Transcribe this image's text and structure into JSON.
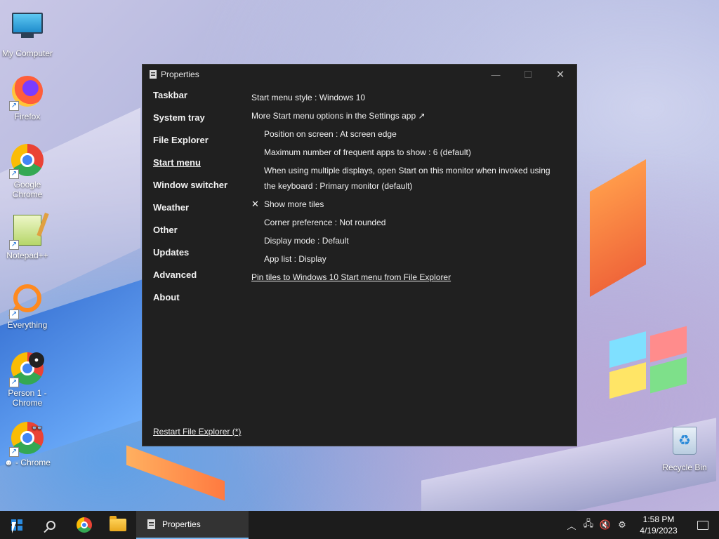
{
  "desktop": {
    "icons": [
      {
        "label": "My Computer",
        "icon": "monitor-icon"
      },
      {
        "label": "Firefox",
        "icon": "firefox-icon"
      },
      {
        "label": "Google Chrome",
        "icon": "chrome-icon"
      },
      {
        "label": "Notepad++",
        "icon": "notepad-plus-plus-icon"
      },
      {
        "label": "Everything",
        "icon": "everything-search-icon"
      },
      {
        "label": "Person 1 - Chrome",
        "icon": "chrome-profile-icon"
      },
      {
        "label": "☻ - Chrome",
        "icon": "chrome-profile-icon"
      },
      {
        "label": "Recycle Bin",
        "icon": "recycle-bin-icon"
      }
    ]
  },
  "window": {
    "title": "Properties",
    "controls": {
      "minimize": "—",
      "maximize": "",
      "close": "✕"
    },
    "nav": {
      "items": [
        {
          "label": "Taskbar"
        },
        {
          "label": "System tray"
        },
        {
          "label": "File Explorer"
        },
        {
          "label": "Start menu",
          "active": true
        },
        {
          "label": "Window switcher"
        },
        {
          "label": "Weather"
        },
        {
          "label": "Other"
        },
        {
          "label": "Updates"
        },
        {
          "label": "Advanced"
        },
        {
          "label": "About"
        }
      ],
      "restart_link": "Restart File Explorer (*)"
    },
    "content": {
      "start_menu_style": "Start menu style : Windows 10",
      "more_options": "More Start menu options in the Settings app ↗",
      "position": "Position on screen : At screen edge",
      "max_frequent": "Maximum number of frequent apps to show : 6 (default)",
      "multi_display": "When using multiple displays, open Start on this monitor when invoked using the keyboard : Primary monitor (default)",
      "show_more_tiles": "Show more tiles",
      "show_more_tiles_check": "✕",
      "corner_pref": "Corner preference : Not rounded",
      "display_mode": "Display mode : Default",
      "app_list": "App list : Display",
      "pin_tiles": "Pin tiles to Windows 10 Start menu from File Explorer"
    }
  },
  "taskbar": {
    "task_label": "Properties",
    "tray": {
      "chevron": "︿",
      "network": "🖧",
      "volume": "🔇",
      "settings": "⚙"
    },
    "clock": {
      "time": "1:58 PM",
      "date": "4/19/2023"
    }
  }
}
